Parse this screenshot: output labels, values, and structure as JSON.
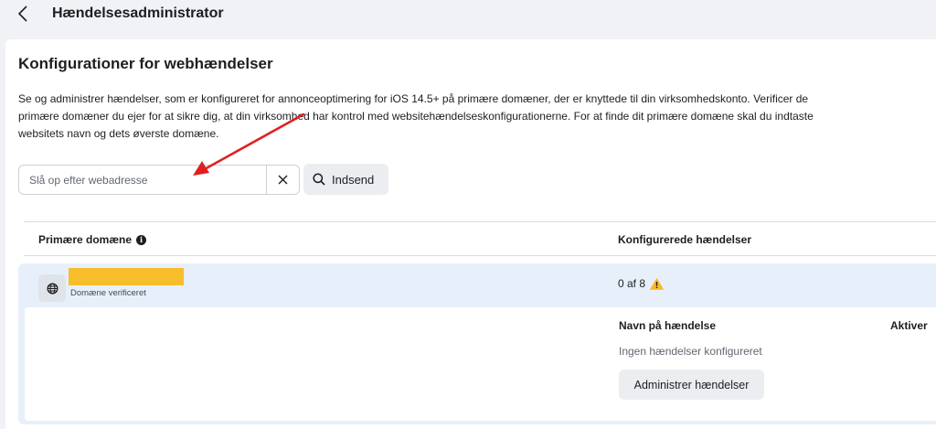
{
  "header": {
    "back_icon": "chevron-left-icon",
    "title": "Hændelsesadministrator"
  },
  "section": {
    "title": "Konfigurationer for webhændelser",
    "description": "Se og administrer hændelser, som er konfigureret for annonceoptimering for iOS 14.5+ på primære domæner, der er knyttede til din virksomhedskonto. Verificer de primære domæner du ejer for at sikre dig, at din virksomhed har kontrol med websitehændelseskonfigurationerne. For at finde dit primære domæne skal du indtaste websitets navn og dets øverste domæne."
  },
  "search": {
    "placeholder": "Slå op efter webadresse",
    "value": "",
    "clear_icon": "close-icon",
    "submit_icon": "search-icon",
    "submit_label": "Indsend"
  },
  "table": {
    "headers": {
      "domain": "Primære domæne",
      "domain_info_icon": "info-icon",
      "events": "Konfigurerede hændelser"
    },
    "rows": [
      {
        "icon": "globe-icon",
        "domain_status": "Domæne verificeret",
        "configured_count": "0 af 8",
        "warning_icon": "warning-icon",
        "expanded": {
          "col_event_name": "Navn på hændelse",
          "col_activate": "Aktiver",
          "empty_text": "Ingen hændelser konfigureret",
          "manage_button": "Administrer hændelser"
        }
      }
    ]
  },
  "colors": {
    "page_bg": "#f0f2f5",
    "row_highlight": "#e7f0fa",
    "redaction": "#f7bd2a",
    "annotation_arrow": "#e02020",
    "warning": "#f7b928"
  }
}
